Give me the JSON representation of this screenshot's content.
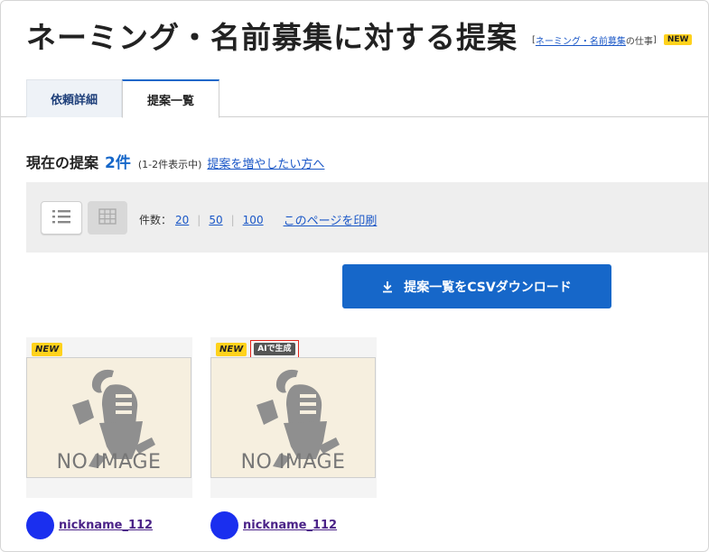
{
  "page": {
    "title": "ネーミング・名前募集に対する提案",
    "category_link": "ネーミング・名前募集",
    "category_suffix": "の仕事",
    "bracket_open": "[",
    "bracket_close": "]",
    "new_badge": "NEW"
  },
  "tabs": [
    {
      "label": "依頼詳細",
      "active": false
    },
    {
      "label": "提案一覧",
      "active": true
    }
  ],
  "proposals": {
    "label": "現在の提案",
    "count": "2件",
    "range": "(1-2件表示中)",
    "more_link": "提案を増やしたい方へ"
  },
  "toolbar": {
    "list_view_icon": "list-icon",
    "grid_view_icon": "grid-icon",
    "per_page_label": "件数：",
    "per_page_options": [
      "20",
      "50",
      "100"
    ],
    "print_link": "このページを印刷"
  },
  "csv_button": {
    "label": "提案一覧をCSVダウンロード",
    "icon": "download-icon"
  },
  "cards": [
    {
      "new_tag": "NEW",
      "ai_tag": "",
      "image_text": "NO IMAGE",
      "user": "nickname_112"
    },
    {
      "new_tag": "NEW",
      "ai_tag": "AIで生成",
      "image_text": "NO IMAGE",
      "user": "nickname_112"
    }
  ],
  "colors": {
    "accent": "#1667c9",
    "badge_yellow": "#ffd21c",
    "avatar": "#1a2fef",
    "highlight_border": "#e2231a"
  }
}
